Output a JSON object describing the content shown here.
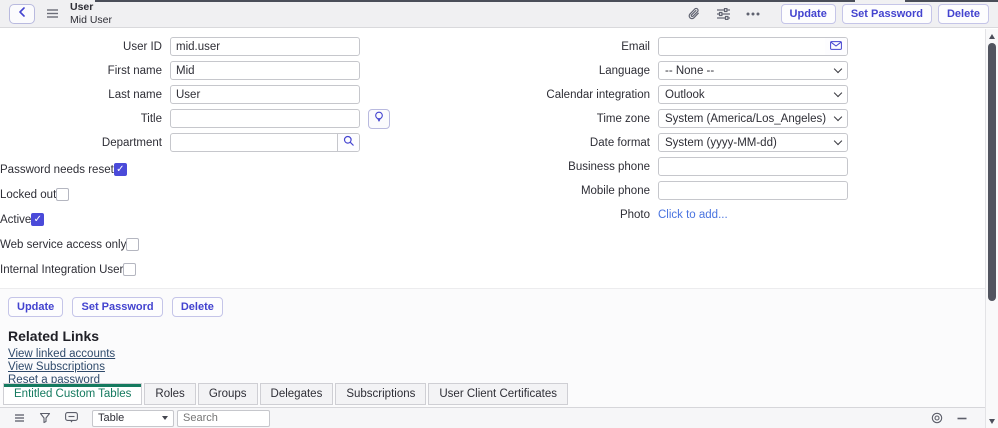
{
  "colors": {
    "accent": "#4343cf",
    "accent_border": "#c5c5e8",
    "tab_active_green": "#157a5f",
    "photo_link_blue": "#4a74e0",
    "related_link_blue": "#2f4a6b",
    "checkbox_checked": "#4a4ad9",
    "scrollbar_thumb": "#51545f",
    "header_bg": "#f0f0f2"
  },
  "header": {
    "title_line1": "User",
    "title_line2": "Mid User",
    "icons": [
      "back-chevron",
      "context-menu",
      "paperclip",
      "form-sliders",
      "more-options"
    ],
    "buttons": {
      "update": "Update",
      "set_password": "Set Password",
      "delete": "Delete"
    }
  },
  "form": {
    "left": [
      {
        "label": "User ID",
        "value": "mid.user"
      },
      {
        "label": "First name",
        "value": "Mid"
      },
      {
        "label": "Last name",
        "value": "User"
      },
      {
        "label": "Title",
        "value": ""
      },
      {
        "label": "Department",
        "value": ""
      }
    ],
    "checkboxes": [
      {
        "label": "Password needs reset",
        "checked": true
      },
      {
        "label": "Locked out",
        "checked": false
      },
      {
        "label": "Active",
        "checked": true
      },
      {
        "label": "Web service access only",
        "checked": false
      },
      {
        "label": "Internal Integration User",
        "checked": false
      }
    ],
    "right": [
      {
        "label": "Email",
        "value": ""
      },
      {
        "label": "Language",
        "value": "-- None --"
      },
      {
        "label": "Calendar integration",
        "value": "Outlook"
      },
      {
        "label": "Time zone",
        "value": "System (America/Los_Angeles)"
      },
      {
        "label": "Date format",
        "value": "System (yyyy-MM-dd)"
      },
      {
        "label": "Business phone",
        "value": ""
      },
      {
        "label": "Mobile phone",
        "value": ""
      },
      {
        "label": "Photo",
        "value": "Click to add..."
      }
    ]
  },
  "footer_buttons": {
    "update": "Update",
    "set_password": "Set Password",
    "delete": "Delete"
  },
  "related_links": {
    "title": "Related Links",
    "links": [
      "View linked accounts",
      "View Subscriptions",
      "Reset a password"
    ]
  },
  "tabs": [
    {
      "label": "Entitled Custom Tables",
      "active": true
    },
    {
      "label": "Roles",
      "active": false
    },
    {
      "label": "Groups",
      "active": false
    },
    {
      "label": "Delegates",
      "active": false
    },
    {
      "label": "Subscriptions",
      "active": false
    },
    {
      "label": "User Client Certificates",
      "active": false
    }
  ],
  "list_toolbar": {
    "table_label": "Table",
    "search_placeholder": "Search",
    "icons": [
      "list-menu",
      "filter-funnel",
      "list-chat",
      "list-settings",
      "minimize"
    ]
  }
}
